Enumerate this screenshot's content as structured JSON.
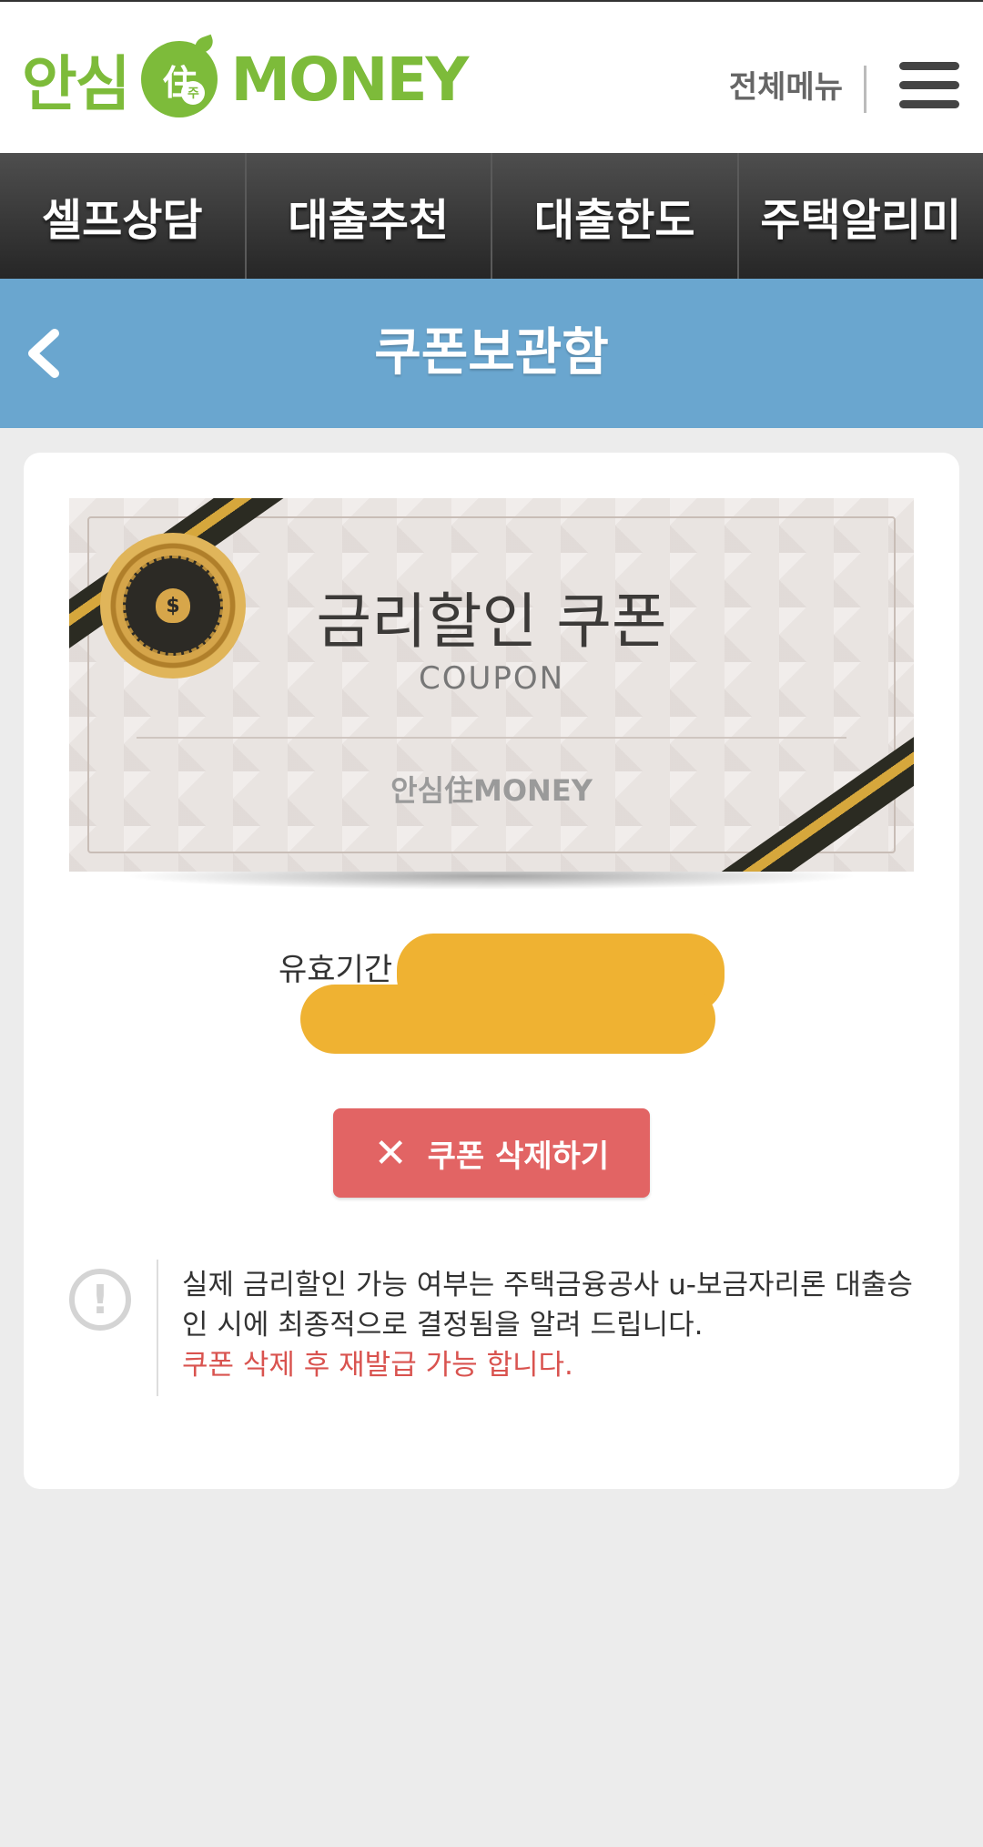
{
  "header": {
    "logo_left": "안심",
    "logo_badge": "住",
    "logo_badge_sub": "주",
    "logo_right": "MONEY",
    "full_menu_label": "전체메뉴"
  },
  "nav": {
    "tabs": [
      {
        "label": "셀프상담"
      },
      {
        "label": "대출추천"
      },
      {
        "label": "대출한도"
      },
      {
        "label": "주택알리미"
      }
    ]
  },
  "titlebar": {
    "title": "쿠폰보관함"
  },
  "coupon": {
    "title": "금리할인 쿠폰",
    "subtitle": "COUPON",
    "brand": "안심住MONEY"
  },
  "validity": {
    "label": "유효기간"
  },
  "delete_button": {
    "icon": "✕",
    "label": "쿠폰 삭제하기"
  },
  "notice": {
    "line1": "실제 금리할인 가능 여부는 주택금융공사 u-보금자리론 대출승인 시에 최종적으로 결정됨을 알려 드립니다.",
    "line2": "쿠폰 삭제 후 재발급 가능 합니다."
  },
  "colors": {
    "brand_green": "#7dbb3a",
    "titlebar_blue": "#6aa6cf",
    "delete_red": "#e26464",
    "redaction": "#efb232"
  }
}
